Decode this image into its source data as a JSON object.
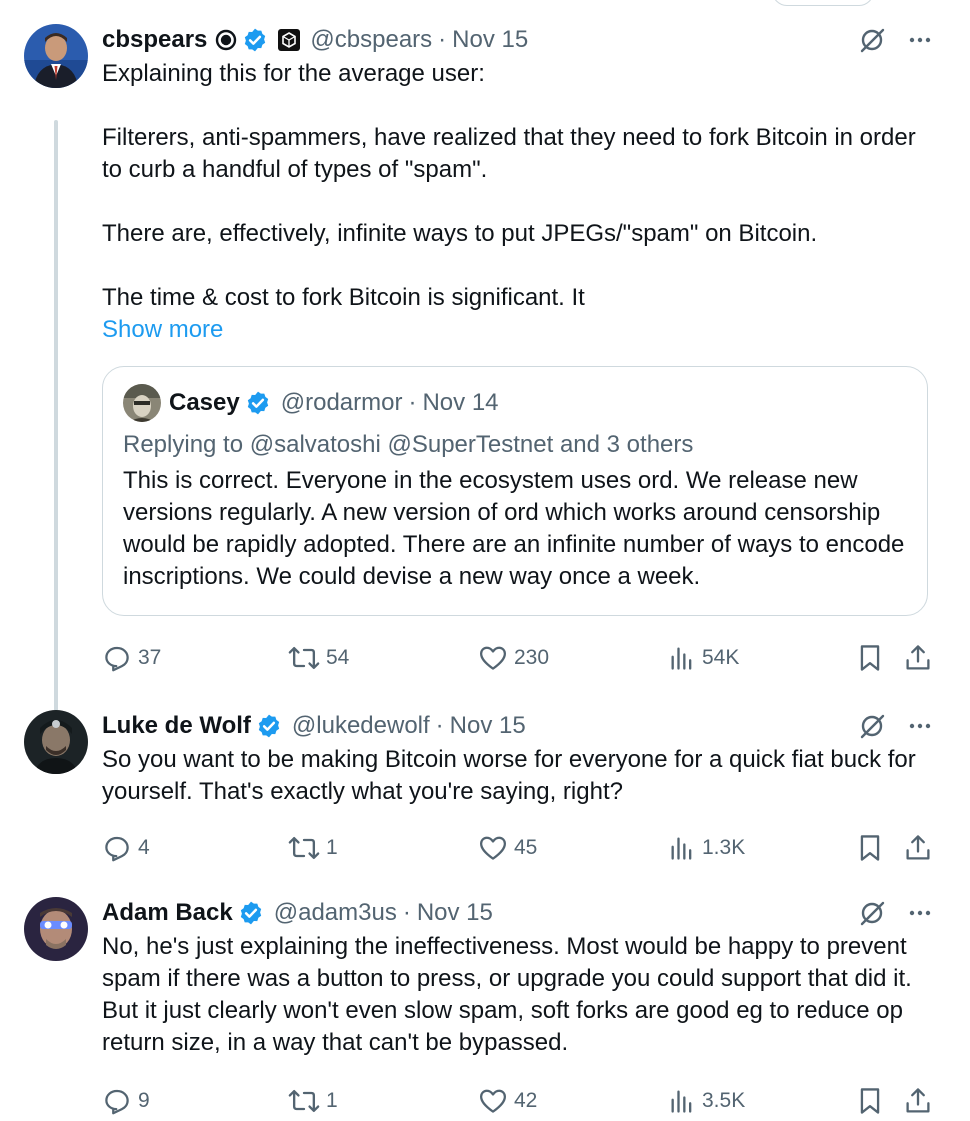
{
  "tweets": [
    {
      "name": "cbspears",
      "handle": "@cbspears",
      "dot": "·",
      "date": "Nov 15",
      "text": "Explaining this for the average user:\n\nFilterers, anti-spammers, have realized that they need to fork Bitcoin in order to curb a handful of types of \"spam\".\n\nThere are, effectively, infinite ways to put JPEGs/\"spam\" on Bitcoin.\n\nThe time & cost to fork Bitcoin is significant. It",
      "show_more": "Show more",
      "quote": {
        "name": "Casey",
        "handle": "@rodarmor",
        "dot": "·",
        "date": "Nov 14",
        "replying": "Replying to @salvatoshi @SuperTestnet and 3 others",
        "text": "This is correct. Everyone in the ecosystem uses ord. We release new versions regularly. A new version of ord which works around censorship would be rapidly adopted. There are an infinite number of ways to encode inscriptions. We could devise a new way once a week."
      },
      "replies": "37",
      "retweets": "54",
      "likes": "230",
      "views": "54K"
    },
    {
      "name": "Luke de Wolf",
      "handle": "@lukedewolf",
      "dot": "·",
      "date": "Nov 15",
      "text": "So you want to be making Bitcoin worse for everyone for a quick fiat buck for yourself. That's exactly what you're saying, right?",
      "replies": "4",
      "retweets": "1",
      "likes": "45",
      "views": "1.3K"
    },
    {
      "name": "Adam Back",
      "handle": "@adam3us",
      "dot": "·",
      "date": "Nov 15",
      "text": "No, he's just explaining the ineffectiveness. Most would be happy to prevent spam if there was a button to press, or upgrade you could support that did it. But it just clearly won't even slow spam, soft forks are good eg to reduce op return size, in a way that can't be bypassed.",
      "replies": "9",
      "retweets": "1",
      "likes": "42",
      "views": "3.5K"
    }
  ],
  "colors": {
    "text": "#0f1419",
    "secondary": "#536471",
    "link": "#1d9bf0",
    "verified": "#1d9bf0",
    "border": "#cfd9de"
  },
  "icons": {
    "reply": "reply-icon",
    "retweet": "retweet-icon",
    "like": "heart-icon",
    "views": "views-icon",
    "bookmark": "bookmark-icon",
    "share": "share-icon",
    "grok": "grok-icon",
    "more": "more-icon"
  }
}
